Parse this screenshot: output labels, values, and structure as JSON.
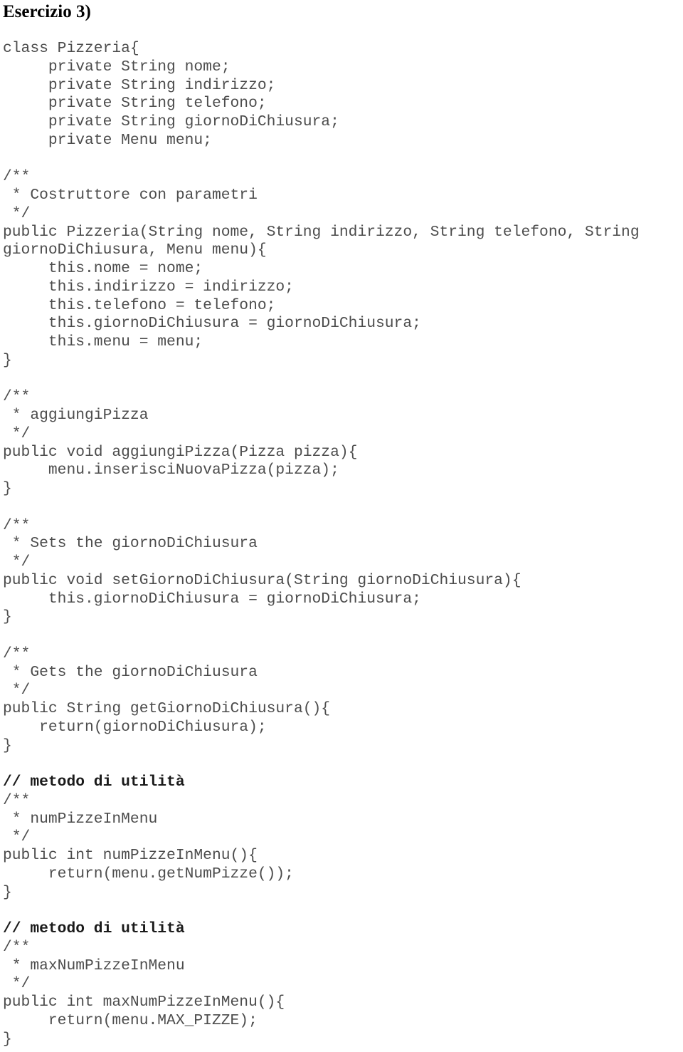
{
  "document": {
    "title": "Esercizio 3)",
    "language": "java",
    "code_lines": [
      {
        "text": "class Pizzeria{",
        "bold": false
      },
      {
        "text": "     private String nome;",
        "bold": false
      },
      {
        "text": "     private String indirizzo;",
        "bold": false
      },
      {
        "text": "     private String telefono;",
        "bold": false
      },
      {
        "text": "     private String giornoDiChiusura;",
        "bold": false
      },
      {
        "text": "     private Menu menu;",
        "bold": false
      },
      {
        "text": "",
        "bold": false
      },
      {
        "text": "/**",
        "bold": false
      },
      {
        "text": " * Costruttore con parametri",
        "bold": false
      },
      {
        "text": " */",
        "bold": false
      },
      {
        "text": "public Pizzeria(String nome, String indirizzo, String telefono, String",
        "bold": false
      },
      {
        "text": "giornoDiChiusura, Menu menu){",
        "bold": false
      },
      {
        "text": "     this.nome = nome;",
        "bold": false
      },
      {
        "text": "     this.indirizzo = indirizzo;",
        "bold": false
      },
      {
        "text": "     this.telefono = telefono;",
        "bold": false
      },
      {
        "text": "     this.giornoDiChiusura = giornoDiChiusura;",
        "bold": false
      },
      {
        "text": "     this.menu = menu;",
        "bold": false
      },
      {
        "text": "}",
        "bold": false
      },
      {
        "text": "",
        "bold": false
      },
      {
        "text": "/**",
        "bold": false
      },
      {
        "text": " * aggiungiPizza",
        "bold": false
      },
      {
        "text": " */",
        "bold": false
      },
      {
        "text": "public void aggiungiPizza(Pizza pizza){",
        "bold": false
      },
      {
        "text": "     menu.inserisciNuovaPizza(pizza);",
        "bold": false
      },
      {
        "text": "}",
        "bold": false
      },
      {
        "text": "",
        "bold": false
      },
      {
        "text": "/**",
        "bold": false
      },
      {
        "text": " * Sets the giornoDiChiusura",
        "bold": false
      },
      {
        "text": " */",
        "bold": false
      },
      {
        "text": "public void setGiornoDiChiusura(String giornoDiChiusura){",
        "bold": false
      },
      {
        "text": "     this.giornoDiChiusura = giornoDiChiusura;",
        "bold": false
      },
      {
        "text": "}",
        "bold": false
      },
      {
        "text": "",
        "bold": false
      },
      {
        "text": "/**",
        "bold": false
      },
      {
        "text": " * Gets the giornoDiChiusura",
        "bold": false
      },
      {
        "text": " */",
        "bold": false
      },
      {
        "text": "public String getGiornoDiChiusura(){",
        "bold": false
      },
      {
        "text": "    return(giornoDiChiusura);",
        "bold": false
      },
      {
        "text": "}",
        "bold": false
      },
      {
        "text": "",
        "bold": false
      },
      {
        "text": "// metodo di utilità",
        "bold": true
      },
      {
        "text": "/**",
        "bold": false
      },
      {
        "text": " * numPizzeInMenu",
        "bold": false
      },
      {
        "text": " */",
        "bold": false
      },
      {
        "text": "public int numPizzeInMenu(){",
        "bold": false
      },
      {
        "text": "     return(menu.getNumPizze());",
        "bold": false
      },
      {
        "text": "}",
        "bold": false
      },
      {
        "text": "",
        "bold": false
      },
      {
        "text": "// metodo di utilità",
        "bold": true
      },
      {
        "text": "/**",
        "bold": false
      },
      {
        "text": " * maxNumPizzeInMenu",
        "bold": false
      },
      {
        "text": " */",
        "bold": false
      },
      {
        "text": "public int maxNumPizzeInMenu(){",
        "bold": false
      },
      {
        "text": "     return(menu.MAX_PIZZE);",
        "bold": false
      },
      {
        "text": "}",
        "bold": false
      }
    ]
  }
}
